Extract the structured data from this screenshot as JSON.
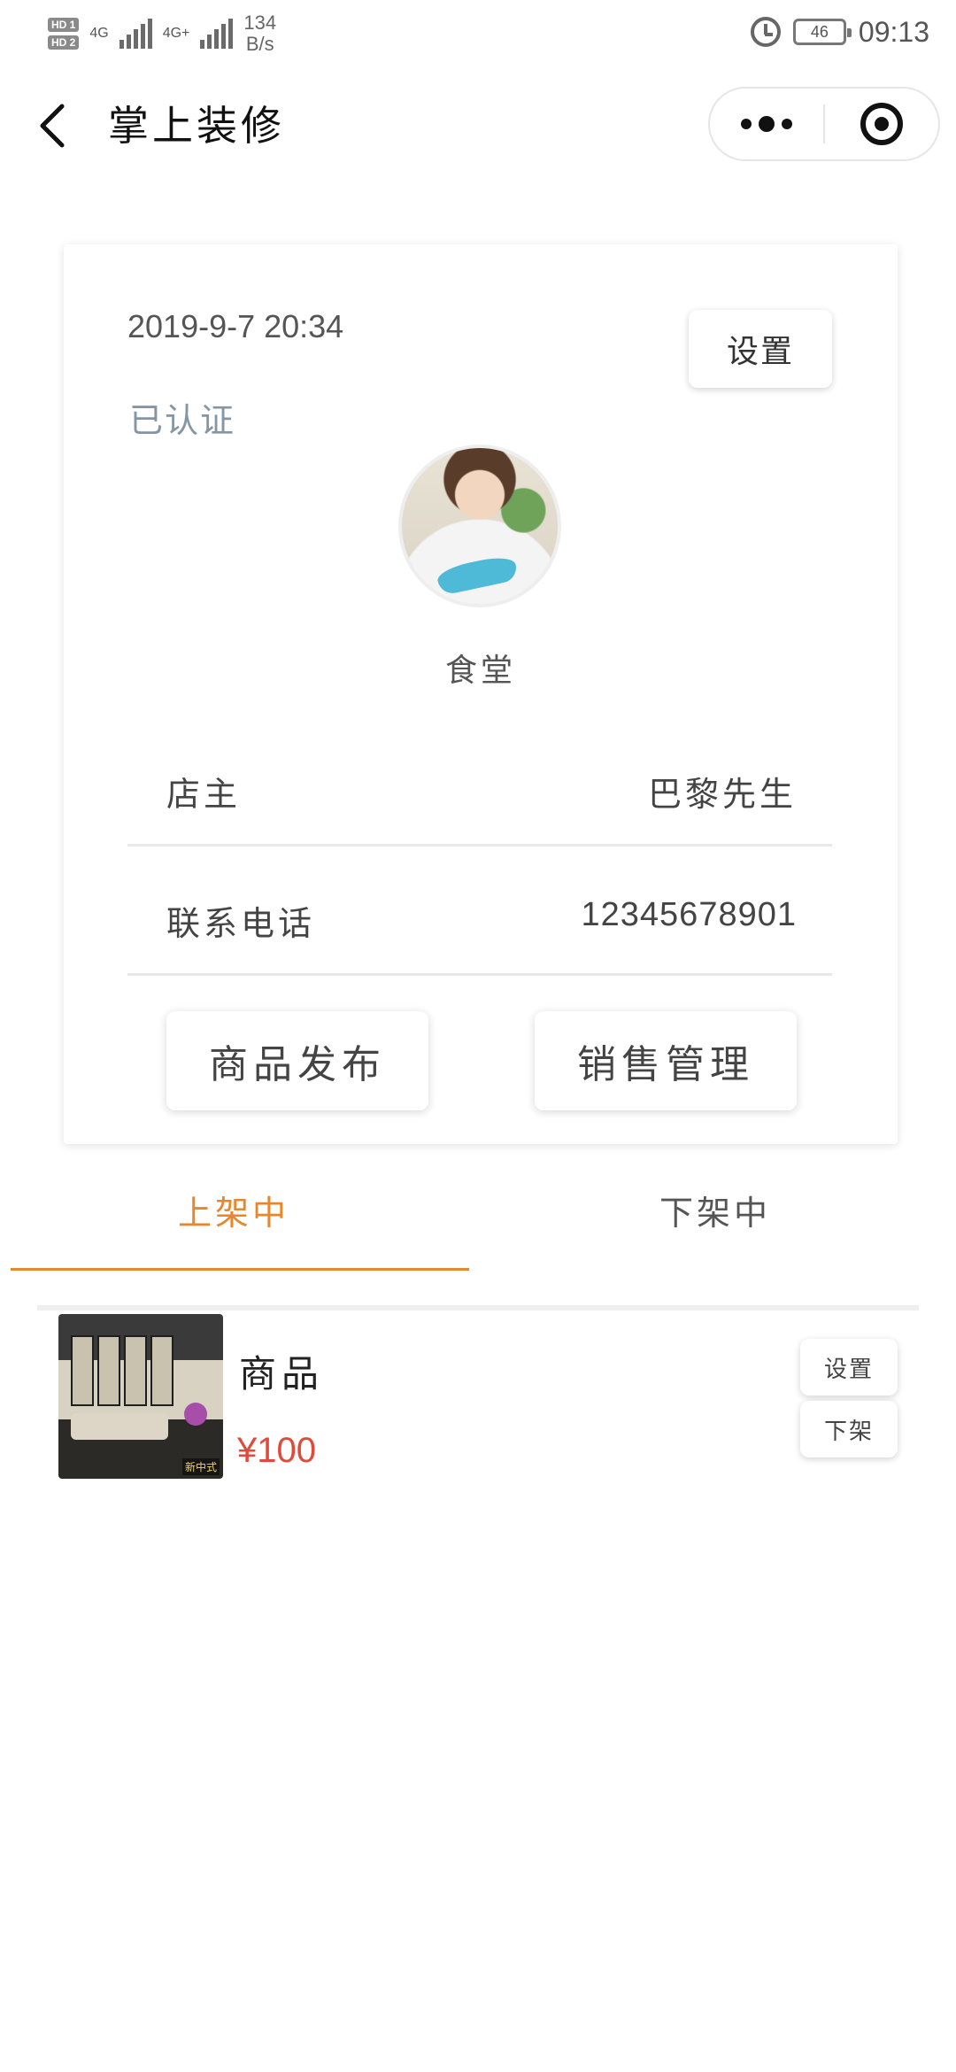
{
  "status_bar": {
    "net1": "4G",
    "net2": "4G+",
    "speed_value": "134",
    "speed_unit": "B/s",
    "battery": "46",
    "time": "09:13"
  },
  "nav": {
    "title": "掌上装修"
  },
  "profile": {
    "date": "2019-9-7 20:34",
    "settings_label": "设置",
    "verified_label": "已认证",
    "shop_name": "食堂",
    "owner_label": "店主",
    "owner_value": "巴黎先生",
    "phone_label": "联系电话",
    "phone_value": "12345678901",
    "publish_label": "商品发布",
    "sales_label": "销售管理"
  },
  "tabs": {
    "items": [
      {
        "label": "上架中",
        "active": true
      },
      {
        "label": "下架中",
        "active": false
      }
    ]
  },
  "products": [
    {
      "name": "商品",
      "price": "¥100",
      "thumb_tag": "新中式",
      "settings_label": "设置",
      "unlist_label": "下架"
    }
  ],
  "colors": {
    "accent": "#e8862b",
    "price": "#e04a3a",
    "verified": "#8496a6"
  }
}
